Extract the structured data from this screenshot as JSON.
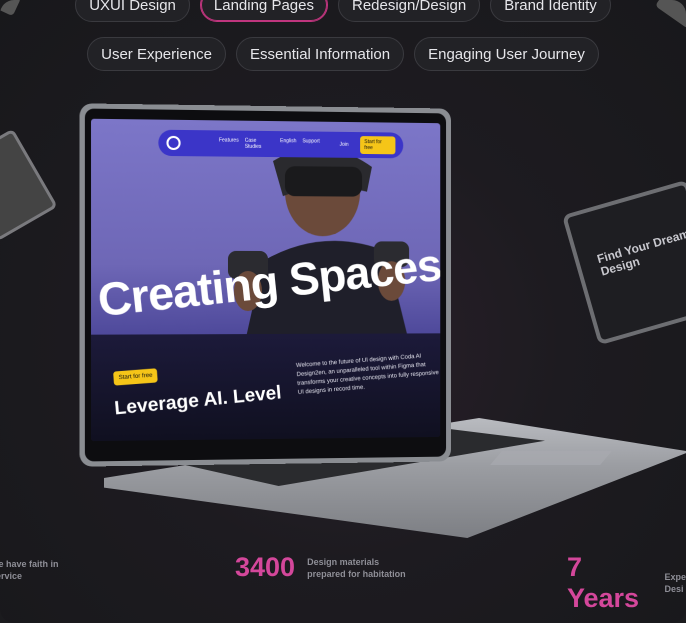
{
  "tags_row1": [
    "UXUI Design",
    "Landing Pages",
    "Redesign/Design",
    "Brand Identity"
  ],
  "tags_row2": [
    "User Experience",
    "Essential Information",
    "Engaging User Journey"
  ],
  "active_tag": "Landing Pages",
  "site": {
    "nav": {
      "links": [
        "Features",
        "Case Studies",
        "English",
        "Support"
      ],
      "join": "Join",
      "cta": "Start for free"
    },
    "headline": "Creating Spaces",
    "start_button": "Start for free",
    "subhead": "Leverage AI. Level",
    "description": "Welcome to the future of UI design with Coda AI Design2en, an unparalleled tool within Figma that transforms your creative concepts into fully responsive UI designs in record time."
  },
  "side_device": {
    "text": "Find Your Dream Design"
  },
  "stats": {
    "left_label": "le have faith in\nervice",
    "middle_number": "3400",
    "middle_label_1": "Design materials",
    "middle_label_2": "prepared for habitation",
    "right_number": "7 Years",
    "right_label_1": "Expe",
    "right_label_2": "Desi"
  },
  "colors": {
    "accent": "#d4479b",
    "nav_blue": "#3b35c8",
    "cta_yellow": "#f5c518"
  }
}
